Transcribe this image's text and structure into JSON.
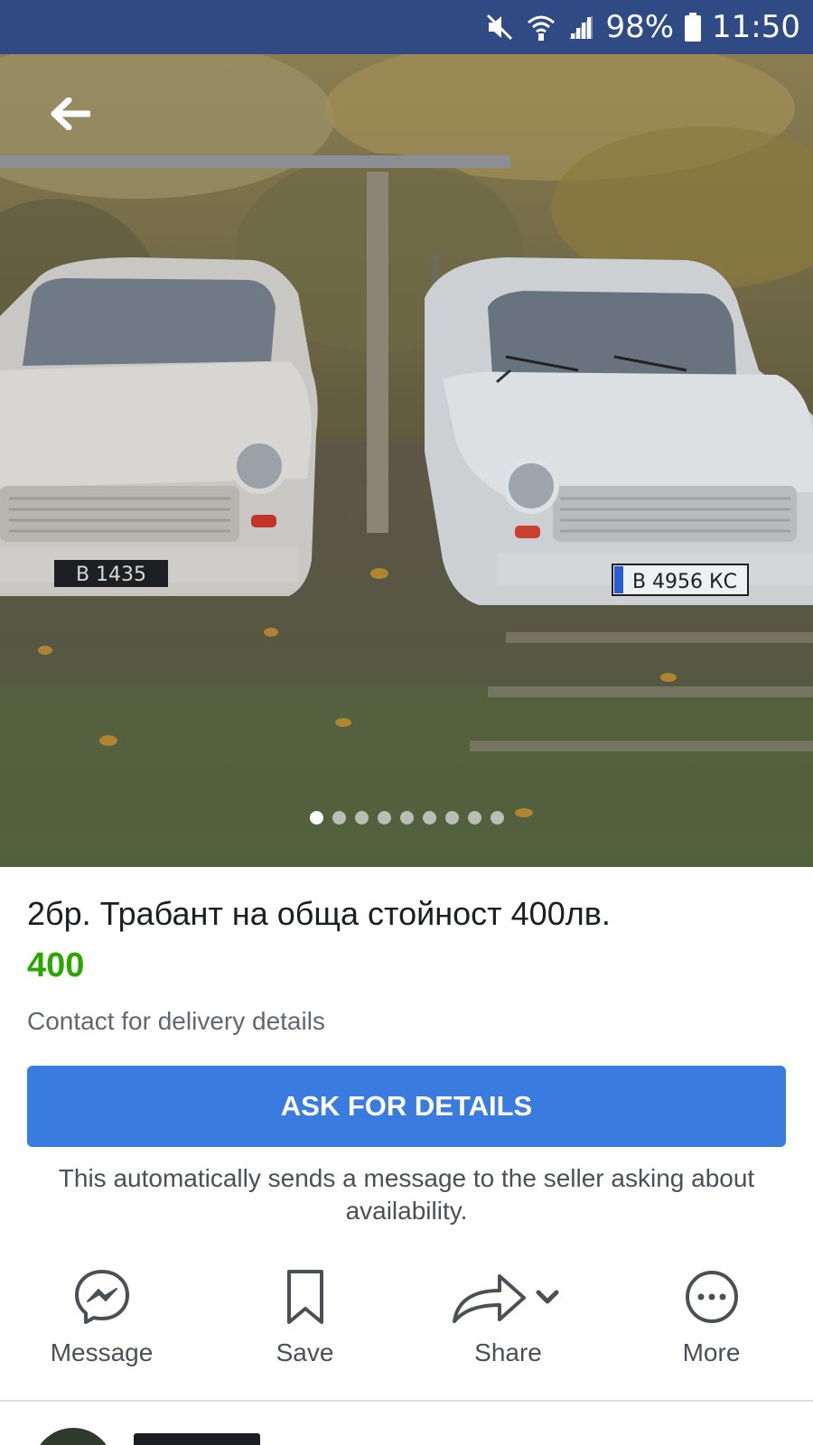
{
  "status_bar": {
    "battery": "98%",
    "time": "11:50",
    "icons": [
      "mute-icon",
      "wifi-icon",
      "signal-icon",
      "battery-icon"
    ]
  },
  "photo": {
    "plates": [
      "В 1435",
      "В 4956 КС"
    ],
    "dot_count": 9,
    "active_dot": 0
  },
  "listing": {
    "title": "2бр. Трабант на обща стойност 400лв.",
    "price": "400",
    "delivery": "Contact for delivery details"
  },
  "ask_button": {
    "label": "ASK FOR DETAILS"
  },
  "auto_note": "This automatically sends a message to the seller asking about availability.",
  "actions": [
    {
      "label": "Message",
      "icon": "messenger-icon"
    },
    {
      "label": "Save",
      "icon": "bookmark-icon"
    },
    {
      "label": "Share",
      "icon": "share-icon"
    },
    {
      "label": "More",
      "icon": "more-icon"
    }
  ],
  "colors": {
    "status_bar": "#2f4a84",
    "primary_button": "#3a7be0",
    "price": "#2ba700"
  }
}
